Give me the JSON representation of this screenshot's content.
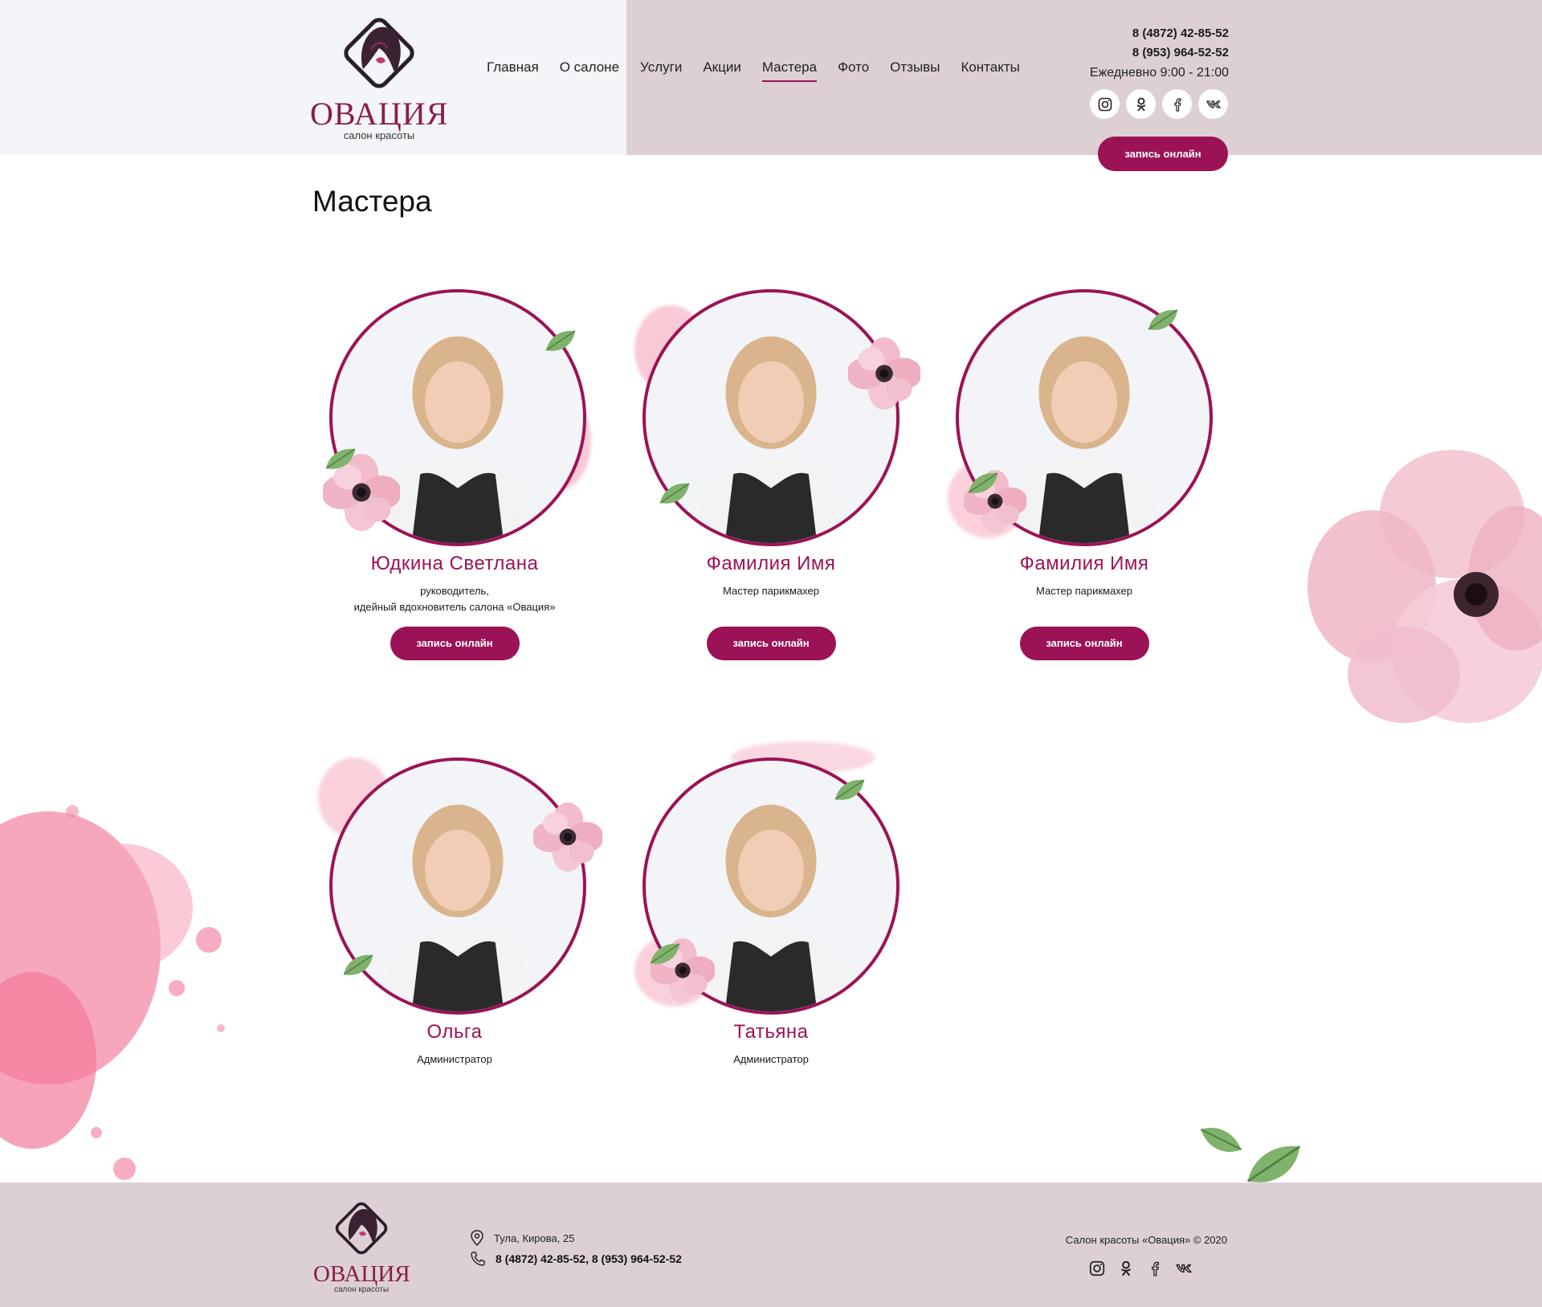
{
  "brand": {
    "name": "ОВАЦИЯ",
    "subtitle": "салон красоты",
    "accent_color": "#9b1356",
    "header_tint": "#ddd0d4"
  },
  "nav": {
    "items": [
      {
        "label": "Главная",
        "active": false
      },
      {
        "label": "О салоне",
        "active": false
      },
      {
        "label": "Услуги",
        "active": false
      },
      {
        "label": "Акции",
        "active": false
      },
      {
        "label": "Мастера",
        "active": true
      },
      {
        "label": "Фото",
        "active": false
      },
      {
        "label": "Отзывы",
        "active": false
      },
      {
        "label": "Контакты",
        "active": false
      }
    ]
  },
  "contacts": {
    "phone1": "8 (4872) 42-85-52",
    "phone2": "8 (953) 964-52-52",
    "hours": "Ежедневно 9:00 - 21:00",
    "socials": [
      "instagram-icon",
      "odnoklassniki-icon",
      "facebook-icon",
      "vk-icon"
    ],
    "book_label": "запись онлайн"
  },
  "page": {
    "title": "Мастера"
  },
  "masters": [
    {
      "name": "Юдкина Светлана",
      "role_line1": "руководитель,",
      "role_line2": "идейный вдохновитель салона «Овация»",
      "button": "запись онлайн"
    },
    {
      "name": "Фамилия Имя",
      "role_line1": "Мастер парикмахер",
      "role_line2": "",
      "button": "запись онлайн"
    },
    {
      "name": "Фамилия Имя",
      "role_line1": "Мастер парикмахер",
      "role_line2": "",
      "button": "запись онлайн"
    },
    {
      "name": "Ольга",
      "role_line1": "Администратор",
      "role_line2": ""
    },
    {
      "name": "Татьяна",
      "role_line1": "Администратор",
      "role_line2": ""
    }
  ],
  "footer": {
    "address": "Тула, Кирова, 25",
    "phones": "8 (4872) 42-85-52, 8 (953) 964-52-52",
    "copyright": "Салон красоты «Овация» © 2020",
    "socials": [
      "instagram-icon",
      "odnoklassniki-icon",
      "facebook-icon",
      "vk-icon"
    ]
  }
}
